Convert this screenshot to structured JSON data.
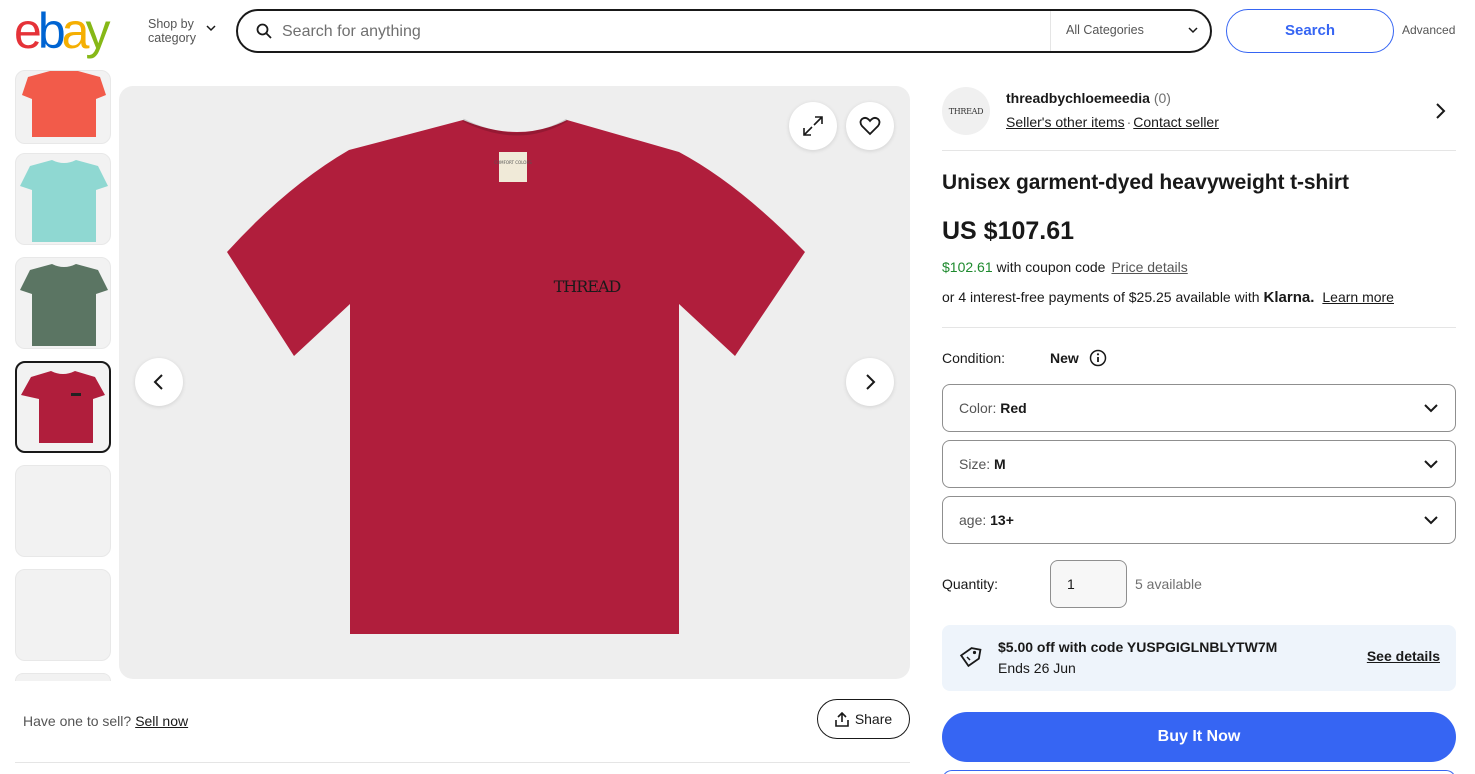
{
  "header": {
    "logo_letters": [
      "e",
      "b",
      "a",
      "y"
    ],
    "shop_by_line1": "Shop by",
    "shop_by_line2": "category",
    "search_placeholder": "Search for anything",
    "category": "All Categories",
    "search_button": "Search",
    "advanced": "Advanced"
  },
  "gallery": {
    "thumbnails": [
      {
        "color": "#f25b4a"
      },
      {
        "color": "#8fd8d2"
      },
      {
        "color": "#5b7563"
      },
      {
        "color": "#b01e3c",
        "selected": true
      },
      {
        "color": ""
      },
      {
        "color": ""
      }
    ],
    "shirt_color": "#b01e3c",
    "shirt_print": "THREAD",
    "neck_label": "COMFORT COLORS"
  },
  "below_image": {
    "have_one": "Have one to sell?",
    "sell_now": "Sell now",
    "share": "Share"
  },
  "seller": {
    "avatar_text": "THREAD",
    "name": "threadbychloemeedia",
    "feedback": "(0)",
    "other_items": "Seller's other items",
    "separator": "·",
    "contact": "Contact seller"
  },
  "item": {
    "title": "Unisex garment-dyed heavyweight t-shirt",
    "price": "US $107.61",
    "coupon_price": "$102.61",
    "coupon_text": "with coupon code",
    "price_details": "Price details",
    "klarna_text": "or 4 interest-free payments of $25.25 available with",
    "klarna_brand": "Klarna.",
    "learn_more": "Learn more"
  },
  "condition": {
    "label": "Condition:",
    "value": "New"
  },
  "options": [
    {
      "label": "Color:",
      "value": "Red"
    },
    {
      "label": "Size:",
      "value": "M"
    },
    {
      "label": "age:",
      "value": "13+"
    }
  ],
  "quantity": {
    "label": "Quantity:",
    "value": "1",
    "available": "5 available"
  },
  "coupon": {
    "title": "$5.00 off with code YUSPGIGLNBLYTW7M",
    "ends": "Ends 26 Jun",
    "details": "See details"
  },
  "buy_now": "Buy It Now",
  "colors": {
    "brand_blue": "#3665f3",
    "coupon_green": "#1e8a2e"
  }
}
